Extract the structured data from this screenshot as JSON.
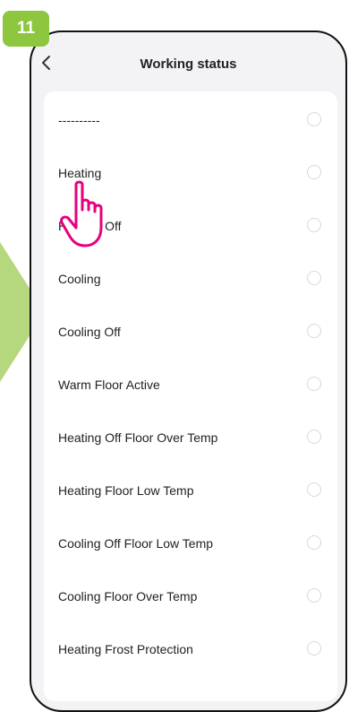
{
  "step": {
    "number": "11"
  },
  "header": {
    "title": "Working status",
    "back_icon": "chevron-left-icon"
  },
  "options": [
    {
      "label": "----------",
      "selected": false
    },
    {
      "label": "Heating",
      "selected": false
    },
    {
      "label": "Heating Off",
      "selected": false
    },
    {
      "label": "Cooling",
      "selected": false
    },
    {
      "label": "Cooling Off",
      "selected": false
    },
    {
      "label": "Warm Floor Active",
      "selected": false
    },
    {
      "label": "Heating Off Floor Over Temp",
      "selected": false
    },
    {
      "label": "Heating Floor Low Temp",
      "selected": false
    },
    {
      "label": "Cooling Off Floor Low Temp",
      "selected": false
    },
    {
      "label": "Cooling Floor Over Temp",
      "selected": false
    },
    {
      "label": "Heating Frost Protection",
      "selected": false
    }
  ],
  "colors": {
    "badge": "#8dc63f",
    "arrow": "#b5d87e",
    "hand": "#e6007e"
  }
}
